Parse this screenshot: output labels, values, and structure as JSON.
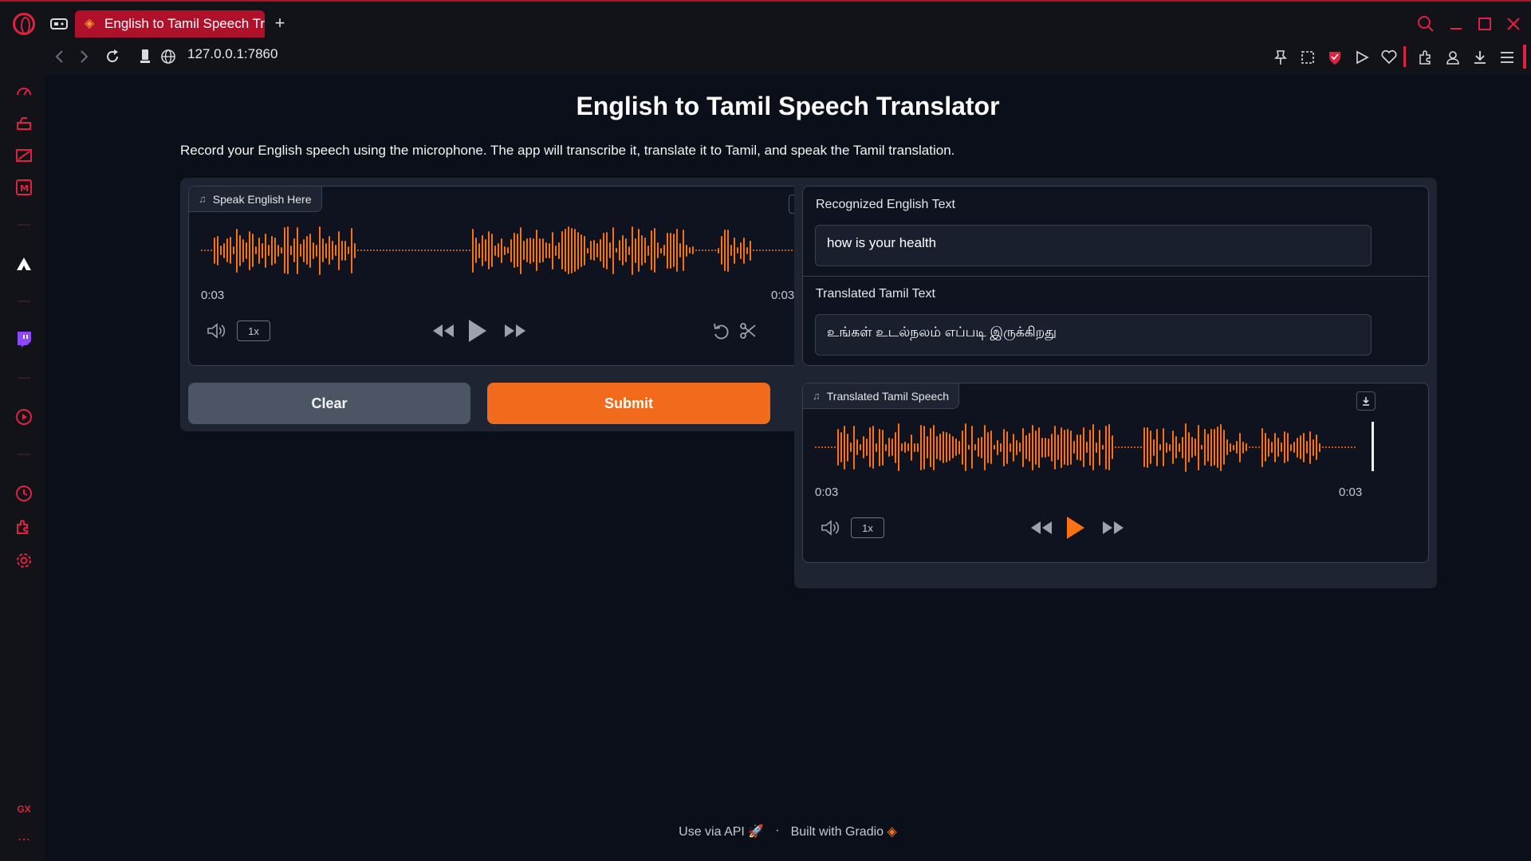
{
  "browser": {
    "tab_title": "English to Tamil Speech Tr",
    "new_tab_label": "+",
    "url": "127.0.0.1:7860"
  },
  "app": {
    "title": "English to Tamil Speech Translator",
    "description": "Record your English speech using the microphone. The app will transcribe it, translate it to Tamil, and speak the Tamil translation."
  },
  "input_audio": {
    "label": "Speak English Here",
    "current_time": "0:03",
    "duration": "0:03",
    "rate": "1x"
  },
  "buttons": {
    "clear": "Clear",
    "submit": "Submit"
  },
  "outputs": {
    "english_label": "Recognized English Text",
    "english_value": "how is your health",
    "tamil_label": "Translated Tamil Text",
    "tamil_value": "உங்கள் உடல்நலம் எப்படி இருக்கிறது",
    "speech_label": "Translated Tamil Speech",
    "speech_current_time": "0:03",
    "speech_duration": "0:03",
    "speech_rate": "1x"
  },
  "footer": {
    "api": "Use via API",
    "separator": "·",
    "built": "Built with Gradio"
  },
  "colors": {
    "accent": "#f97316",
    "browser_accent": "#e0213f"
  }
}
